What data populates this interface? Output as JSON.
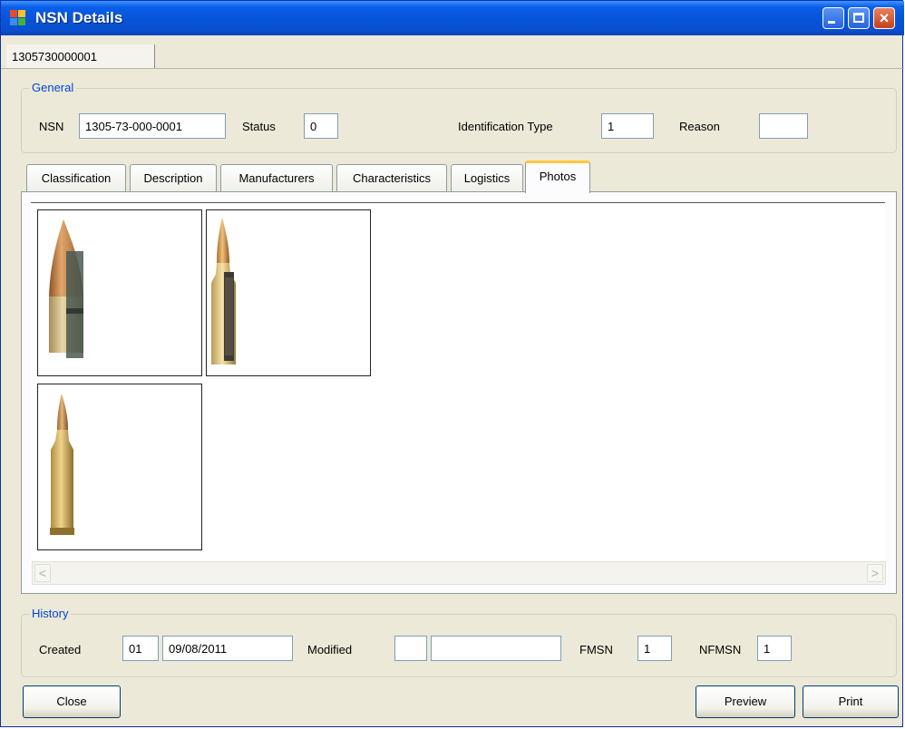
{
  "window": {
    "title": "NSN Details",
    "controls": {
      "minimize": "minimize",
      "maximize": "maximize",
      "close": "×"
    }
  },
  "doc_tab": {
    "label": "1305730000001"
  },
  "general": {
    "legend": "General",
    "nsn_label": "NSN",
    "nsn_value": "1305-73-000-0001",
    "status_label": "Status",
    "status_value": "0",
    "identification_type_label": "Identification Type",
    "identification_type_value": "1",
    "reason_label": "Reason",
    "reason_value": ""
  },
  "tabs": [
    {
      "label": "Classification",
      "active": false
    },
    {
      "label": "Description",
      "active": false
    },
    {
      "label": "Manufacturers",
      "active": false
    },
    {
      "label": "Characteristics",
      "active": false
    },
    {
      "label": "Logistics",
      "active": false
    },
    {
      "label": "Photos",
      "active": true
    }
  ],
  "photos": [
    {
      "subject": "cartridge-bullet-closeup"
    },
    {
      "subject": "cartridge-cutaway"
    },
    {
      "subject": "cartridge-full"
    }
  ],
  "scrollbar": {
    "left_arrow": "<",
    "right_arrow": ">"
  },
  "history": {
    "legend": "History",
    "created_label": "Created",
    "created_code": "01",
    "created_date": "09/08/2011",
    "modified_label": "Modified",
    "modified_code": "",
    "modified_date": "",
    "fmsn_label": "FMSN",
    "fmsn_value": "1",
    "nfmsn_label": "NFMSN",
    "nfmsn_value": "1"
  },
  "buttons": {
    "close": "Close",
    "preview": "Preview",
    "print": "Print"
  },
  "colors": {
    "title_bar": "#0553d8",
    "group_legend": "#0046d5",
    "active_tab_highlight": "#ffc83c",
    "window_bg": "#ece9d8"
  }
}
